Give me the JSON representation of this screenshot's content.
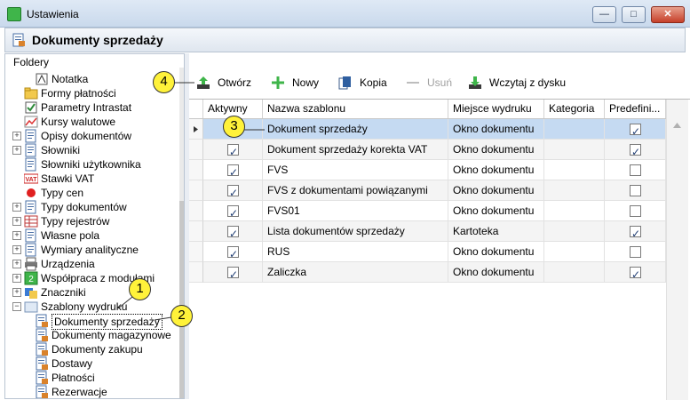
{
  "window": {
    "title": "Ustawienia",
    "buttons": {
      "minimize": "—",
      "maximize": "□",
      "close": "✕"
    }
  },
  "header": {
    "title": "Dokumenty sprzedaży"
  },
  "folders": {
    "title": "Foldery",
    "items": [
      {
        "label": "Notatka",
        "icon": "note-icon"
      },
      {
        "label": "Formy płatności",
        "icon": "payment-folder-icon"
      },
      {
        "label": "Parametry Intrastat",
        "icon": "intrastat-icon"
      },
      {
        "label": "Kursy walutowe",
        "icon": "chart-icon"
      },
      {
        "label": "Opisy dokumentów",
        "icon": "document-icon",
        "expander": "+"
      },
      {
        "label": "Słowniki",
        "icon": "document-icon",
        "expander": "+"
      },
      {
        "label": "Słowniki użytkownika",
        "icon": "document-icon"
      },
      {
        "label": "Stawki VAT",
        "icon": "vat-icon",
        "badge": "VAT"
      },
      {
        "label": "Typy cen",
        "icon": "red-dot-icon"
      },
      {
        "label": "Typy dokumentów",
        "icon": "document-icon",
        "expander": "+"
      },
      {
        "label": "Typy rejestrów",
        "icon": "grid-icon",
        "expander": "+"
      },
      {
        "label": "Własne pola",
        "icon": "document-icon",
        "expander": "+"
      },
      {
        "label": "Wymiary analityczne",
        "icon": "document-icon",
        "expander": "+"
      },
      {
        "label": "Urządzenia",
        "icon": "printer-icon",
        "expander": "+"
      },
      {
        "label": "Współpraca z modułami",
        "icon": "module-icon",
        "expander": "+"
      },
      {
        "label": "Znaczniki",
        "icon": "tag-icon",
        "expander": "+"
      },
      {
        "label": "Szablony wydruku",
        "icon": "folder-open-icon",
        "expander": "−"
      },
      {
        "label": "Dokumenty sprzedaży",
        "icon": "template-icon",
        "selected": true
      },
      {
        "label": "Dokumenty magazynowe",
        "icon": "template-icon"
      },
      {
        "label": "Dokumenty zakupu",
        "icon": "template-icon"
      },
      {
        "label": "Dostawy",
        "icon": "template-icon"
      },
      {
        "label": "Płatności",
        "icon": "template-icon"
      },
      {
        "label": "Rezerwacje",
        "icon": "template-icon"
      }
    ]
  },
  "toolbar": {
    "open": "Otwórz",
    "new": "Nowy",
    "copy": "Kopia",
    "delete": "Usuń",
    "load": "Wczytaj z dysku"
  },
  "grid": {
    "columns": [
      "Aktywny",
      "Nazwa szablonu",
      "Miejsce wydruku",
      "Kategoria",
      "Predefini..."
    ],
    "rows": [
      {
        "active": false,
        "name": "Dokument sprzedaży",
        "place": "Okno dokumentu",
        "category": "",
        "predefined": true,
        "selected": true
      },
      {
        "active": true,
        "name": "Dokument sprzedaży korekta VAT",
        "place": "Okno dokumentu",
        "category": "",
        "predefined": true
      },
      {
        "active": true,
        "name": "FVS",
        "place": "Okno dokumentu",
        "category": "",
        "predefined": false
      },
      {
        "active": true,
        "name": "FVS z dokumentami powiązanymi",
        "place": "Okno dokumentu",
        "category": "",
        "predefined": false
      },
      {
        "active": true,
        "name": "FVS01",
        "place": "Okno dokumentu",
        "category": "",
        "predefined": false
      },
      {
        "active": true,
        "name": "Lista dokumentów sprzedaży",
        "place": "Kartoteka",
        "category": "",
        "predefined": true
      },
      {
        "active": true,
        "name": "RUS",
        "place": "Okno dokumentu",
        "category": "",
        "predefined": false
      },
      {
        "active": true,
        "name": "Zaliczka",
        "place": "Okno dokumentu",
        "category": "",
        "predefined": true
      }
    ]
  },
  "callouts": [
    "1",
    "2",
    "3",
    "4"
  ],
  "colors": {
    "selected_row": "#c5daf2",
    "callout": "#fff23a",
    "accent_green": "#3fb54a"
  }
}
